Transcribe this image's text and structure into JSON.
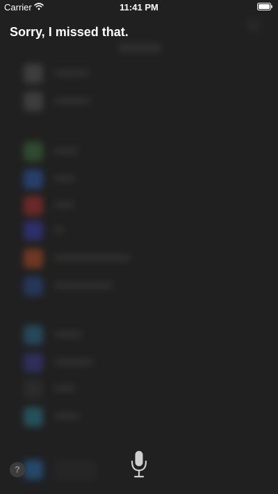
{
  "status_bar": {
    "carrier": "Carrier",
    "time": "11:41 PM",
    "wifi_icon": "wifi-icon",
    "battery_icon": "battery-full-icon"
  },
  "siri": {
    "response": "Sorry, I missed that.",
    "help_label": "?",
    "mic_icon": "microphone-icon"
  },
  "colors": {
    "background": "#202020",
    "text": "#ffffff",
    "help_bg": "#3c3c3c"
  }
}
